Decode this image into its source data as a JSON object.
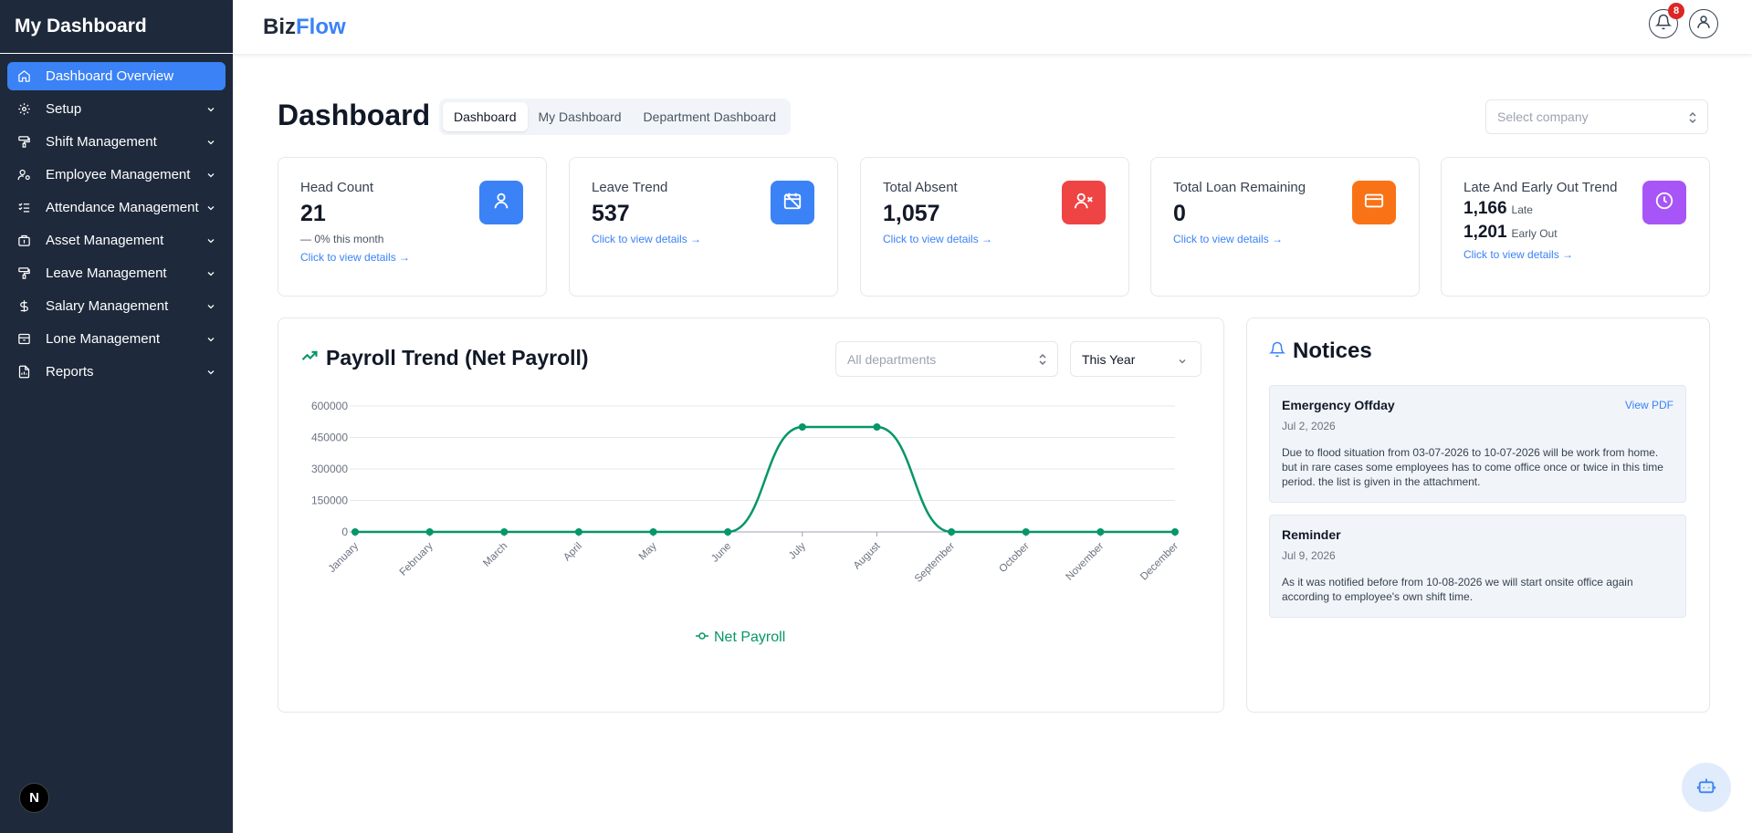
{
  "sidebar": {
    "title": "My Dashboard",
    "items": [
      {
        "label": "Dashboard Overview",
        "icon": "home-icon"
      },
      {
        "label": "Setup",
        "icon": "gear-icon"
      },
      {
        "label": "Shift Management",
        "icon": "roller-icon"
      },
      {
        "label": "Employee Management",
        "icon": "user-cog-icon"
      },
      {
        "label": "Attendance Management",
        "icon": "list-check-icon"
      },
      {
        "label": "Asset Management",
        "icon": "building-icon"
      },
      {
        "label": "Leave Management",
        "icon": "roller-icon"
      },
      {
        "label": "Salary Management",
        "icon": "dollar-icon"
      },
      {
        "label": "Lone Management",
        "icon": "archive-icon"
      },
      {
        "label": "Reports",
        "icon": "report-icon"
      }
    ],
    "footer_badge": "N"
  },
  "topbar": {
    "brand_part1": "Biz",
    "brand_part2": "Flow",
    "notification_count": "8"
  },
  "main": {
    "title": "Dashboard",
    "tabs": [
      {
        "label": "Dashboard"
      },
      {
        "label": "My Dashboard"
      },
      {
        "label": "Department Dashboard"
      }
    ],
    "company_placeholder": "Select company"
  },
  "cards": {
    "headcount": {
      "title": "Head Count",
      "value": "21",
      "sub": "0% this month",
      "link": "Click to view details →",
      "color": "#3b82f6"
    },
    "leave": {
      "title": "Leave Trend",
      "value": "537",
      "link": "Click to view details →",
      "color": "#3b82f6"
    },
    "absent": {
      "title": "Total Absent",
      "value": "1,057",
      "link": "Click to view details →",
      "color": "#ef4444"
    },
    "loan": {
      "title": "Total Loan Remaining",
      "value": "0",
      "link": "Click to view details →",
      "color": "#f97316"
    },
    "late": {
      "title": "Late And Early Out Trend",
      "late_value": "1,166",
      "late_label": "Late",
      "early_value": "1,201",
      "early_label": "Early Out",
      "link": "Click to view details →",
      "color": "#a855f7"
    }
  },
  "payroll": {
    "title": "Payroll Trend (Net Payroll)",
    "dept_placeholder": "All departments",
    "period": "This Year"
  },
  "chart_data": {
    "type": "line",
    "title": "Payroll Trend (Net Payroll)",
    "categories": [
      "January",
      "February",
      "March",
      "April",
      "May",
      "June",
      "July",
      "August",
      "September",
      "October",
      "November",
      "December"
    ],
    "series": [
      {
        "name": "Net Payroll",
        "values": [
          0,
          0,
          0,
          0,
          0,
          0,
          500000,
          500000,
          0,
          0,
          0,
          0
        ],
        "color": "#059669"
      }
    ],
    "y_ticks": [
      "600000",
      "450000",
      "300000",
      "150000",
      "0"
    ],
    "ylim": [
      0,
      600000
    ],
    "grid": true,
    "legend": "bottom"
  },
  "notices": {
    "title": "Notices",
    "items": [
      {
        "title": "Emergency Offday",
        "date": "Jul 2, 2026",
        "body": "Due to flood situation from 03-07-2026 to 10-07-2026 will be work from home. but in rare cases some employees has to come office once or twice in this time period. the list is given in the attachment.",
        "link": "View PDF"
      },
      {
        "title": "Reminder",
        "date": "Jul 9, 2026",
        "body": "As it was notified before from 10-08-2026 we will start onsite office again according to employee's own shift time."
      }
    ]
  }
}
